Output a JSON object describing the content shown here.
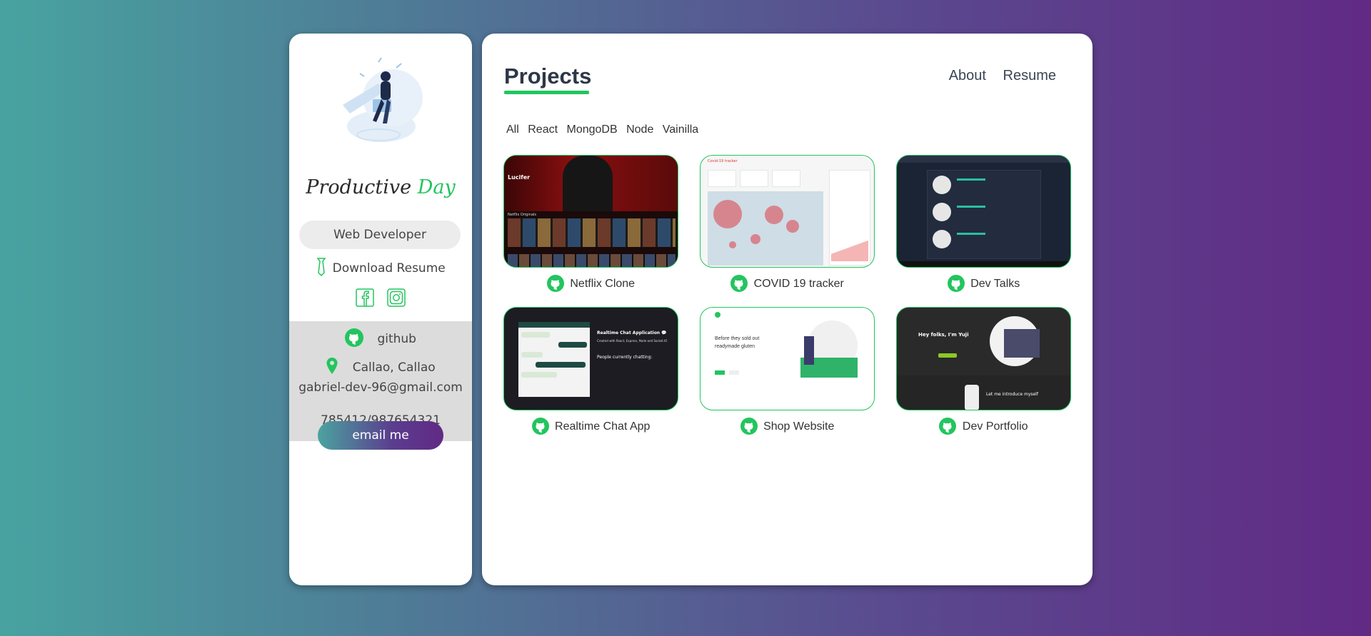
{
  "sidebar": {
    "brand_part1": "Productive",
    "brand_part2": "Day",
    "role": "Web Developer",
    "download_label": "Download Resume",
    "github_label": "github",
    "location": "Callao, Callao",
    "email": "gabriel-dev-96@gmail.com",
    "phone": "785412/987654321",
    "email_button": "email me"
  },
  "main": {
    "title": "Projects",
    "nav": [
      "About",
      "Resume"
    ],
    "filters": [
      "All",
      "React",
      "MongoDB",
      "Node",
      "Vainilla"
    ],
    "projects": [
      {
        "name": "Netflix Clone"
      },
      {
        "name": "COVID 19 tracker"
      },
      {
        "name": "Dev Talks"
      },
      {
        "name": "Realtime Chat App"
      },
      {
        "name": "Shop Website"
      },
      {
        "name": "Dev Portfolio"
      }
    ]
  },
  "thumb_text": {
    "netflix_show": "Lucifer",
    "netflix_row": "Netflix Originals",
    "covid_header": "Covid-19 tracker",
    "chat_title": "Realtime Chat Application 💬",
    "chat_sub": "Created with React, Express, Node and Socket.IO",
    "chat_people": "People currently chatting:",
    "shop_heading1": "Before they sold out",
    "shop_heading2": "readymade gluten",
    "portfolio_greet": "Hey folks, I'm Yuji",
    "portfolio_intro": "Let me introduce myself"
  },
  "colors": {
    "accent": "#22c55e",
    "bg_start": "#48a3a0",
    "bg_end": "#612a85"
  }
}
